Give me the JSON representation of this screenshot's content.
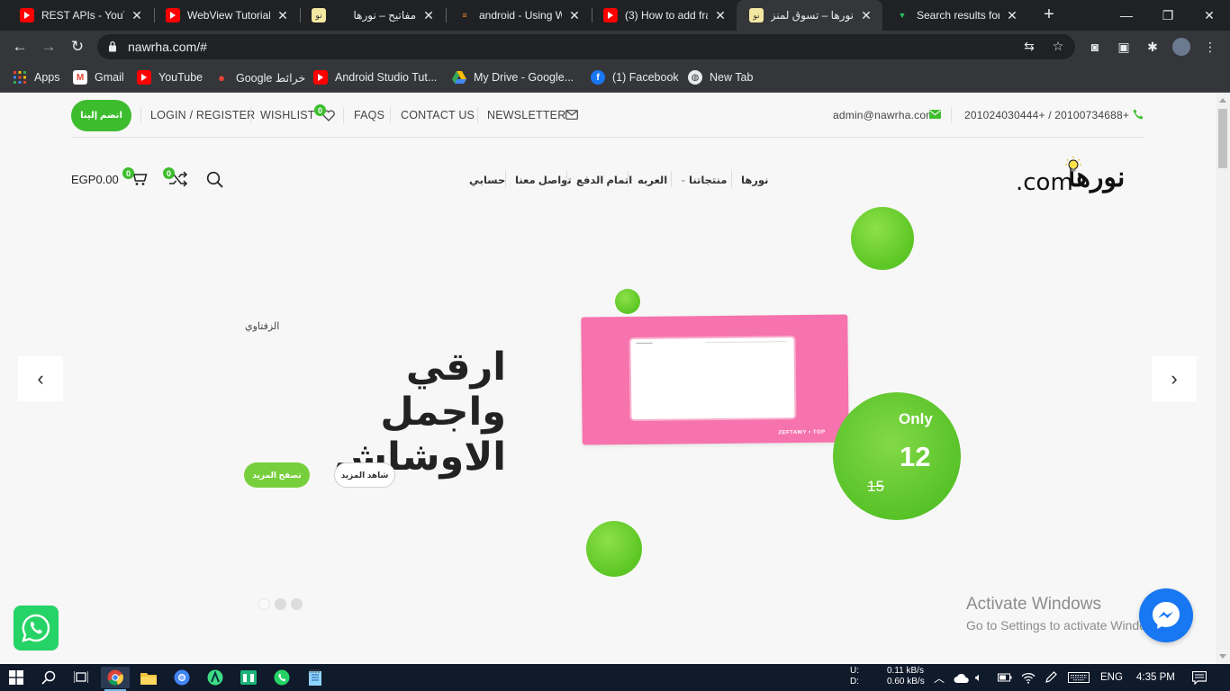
{
  "browser": {
    "tabs": [
      {
        "title": "REST APIs - YouTu",
        "icon": "youtube-icon",
        "active": false
      },
      {
        "title": "WebView Tutorial",
        "icon": "youtube-icon",
        "active": false
      },
      {
        "title": "مفاتيح – نورها",
        "icon": "nawrha-icon",
        "active": false
      },
      {
        "title": "android - Using W",
        "icon": "stackoverflow-icon",
        "active": false
      },
      {
        "title": "(3) How to add fra",
        "icon": "youtube-icon",
        "active": false
      },
      {
        "title": "نورها – تسوق لمنزلك",
        "icon": "nawrha-icon",
        "active": true
      },
      {
        "title": "Search results for",
        "icon": "vuetify-icon",
        "active": false
      }
    ],
    "url": "nawrha.com/#",
    "bookmarks": [
      {
        "label": "Apps",
        "icon": "apps-grid-icon"
      },
      {
        "label": "Gmail",
        "icon": "gmail-icon"
      },
      {
        "label": "YouTube",
        "icon": "youtube-icon"
      },
      {
        "label": "Google خرائط",
        "icon": "maps-icon"
      },
      {
        "label": "Android Studio Tut...",
        "icon": "youtube-icon"
      },
      {
        "label": "My Drive - Google...",
        "icon": "drive-icon"
      },
      {
        "label": "(1) Facebook",
        "icon": "facebook-icon"
      },
      {
        "label": "New Tab",
        "icon": "globe-icon"
      }
    ]
  },
  "site": {
    "topbar": {
      "join_label": "انضم إلينا",
      "login_label": "LOGIN / REGISTER",
      "wishlist_label": "WISHLIST",
      "wishlist_count": "0",
      "faqs_label": "FAQS",
      "contact_label": "CONTACT US",
      "newsletter_label": "NEWSLETTER",
      "email": "admin@nawrha.com",
      "phones": "201024030444+ / 20100734688+"
    },
    "nav": {
      "cart_total": "EGP0.00",
      "cart_count": "0",
      "compare_count": "0",
      "items": [
        {
          "label": "نورها"
        },
        {
          "label": "منتجاتنا"
        },
        {
          "label": "العربه"
        },
        {
          "label": "اتمام الدفع"
        },
        {
          "label": "تواصل معنا"
        },
        {
          "label": "حسابي"
        }
      ],
      "logo_text": ".com",
      "logo_script": "نورها"
    },
    "hero": {
      "subtitle": "الزفتاوي",
      "title_line1": "ارقي واجمل",
      "title_line2": "الاوشاش",
      "btn_primary": "تصفح المزيد",
      "btn_secondary": "شاهد المزيد",
      "product_brand": "ZEFTAWY • TOP",
      "price_label": "Only",
      "price_now": "12",
      "price_old": "15",
      "slides": 3,
      "active_slide": 1
    },
    "watermark": {
      "line1": "Activate Windows",
      "line2": "Go to Settings to activate Windows."
    }
  },
  "taskbar": {
    "net_up_label": "U:",
    "net_up": "0.11 kB/s",
    "net_down_label": "D:",
    "net_down": "0.60 kB/s",
    "lang": "ENG",
    "time": "4:35 PM"
  },
  "colors": {
    "brand_green": "#3dbd2e",
    "circle_green": "#6fd136",
    "product_pink": "#f673ad",
    "messenger_blue": "#1877f2"
  }
}
